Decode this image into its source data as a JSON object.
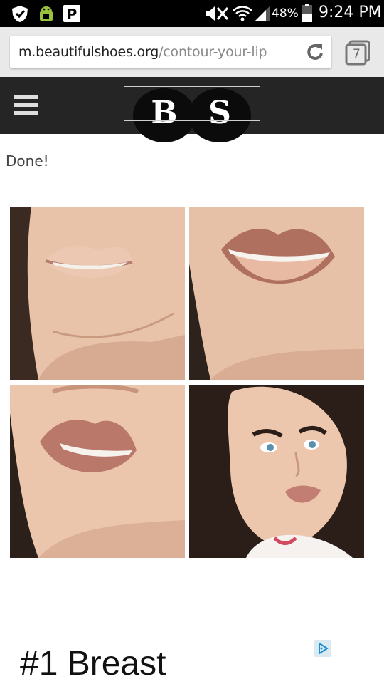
{
  "status_bar": {
    "battery_percent": "48%",
    "time": "9:24 PM"
  },
  "browser": {
    "url_domain": "m.beautifulshoes.org",
    "url_path": "/contour-your-lip",
    "tab_count": "7"
  },
  "site": {
    "logo_left": "B",
    "logo_right": "S"
  },
  "article": {
    "caption": "Done!",
    "photos": [
      {
        "icon": "lips-bare-photo"
      },
      {
        "icon": "lips-lined-photo"
      },
      {
        "icon": "lips-filled-photo"
      },
      {
        "icon": "finished-look-photo"
      }
    ]
  },
  "ad": {
    "heading": "#1 Breast"
  },
  "colors": {
    "status_bar": "#000000",
    "url_bar_bg": "#e9e9e9",
    "header_bg": "#252525",
    "url_path": "#8a8a8a",
    "ad_choices": "#1a8fd0"
  }
}
